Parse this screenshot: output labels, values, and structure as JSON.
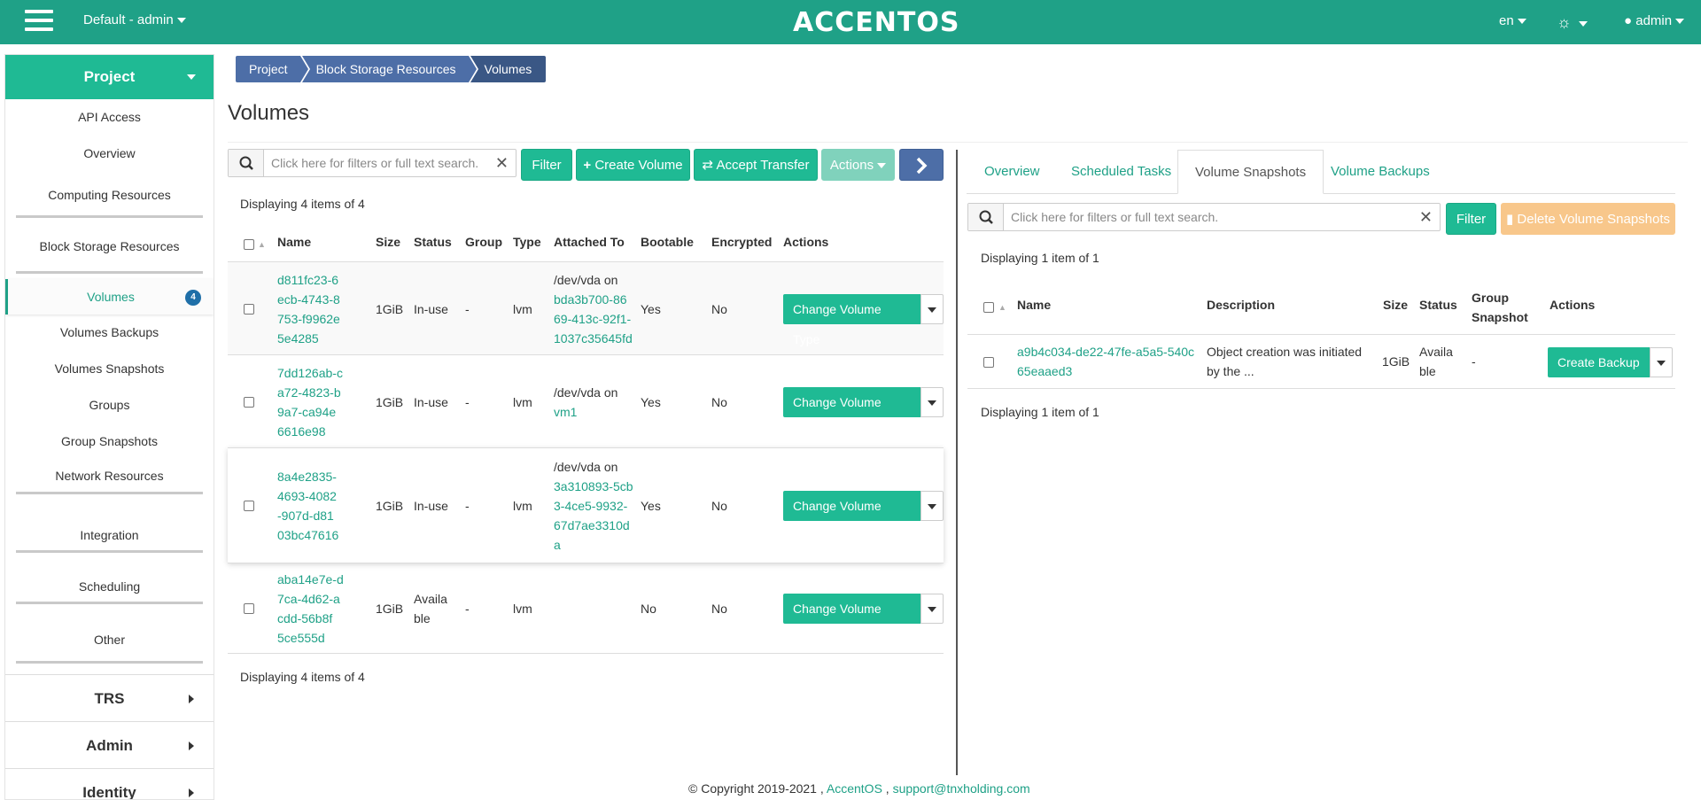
{
  "topbar": {
    "project_switch": "Default - admin",
    "logo": "ACCENTOS",
    "lang": "en",
    "user": "admin"
  },
  "sidebar": {
    "project": "Project",
    "items": [
      {
        "label": "API Access",
        "kind": "sub"
      },
      {
        "label": "Overview",
        "kind": "sub"
      },
      {
        "label": "Computing Resources",
        "kind": "group"
      },
      {
        "label": "Block Storage Resources",
        "kind": "group"
      },
      {
        "label": "Volumes",
        "kind": "active",
        "badge": "4"
      },
      {
        "label": "Volumes Backups",
        "kind": "sub"
      },
      {
        "label": "Volumes Snapshots",
        "kind": "sub"
      },
      {
        "label": "Groups",
        "kind": "sub"
      },
      {
        "label": "Group Snapshots",
        "kind": "sub"
      },
      {
        "label": "Network Resources",
        "kind": "group"
      },
      {
        "label": "Integration",
        "kind": "group"
      },
      {
        "label": "Scheduling",
        "kind": "group"
      },
      {
        "label": "Other",
        "kind": "group"
      }
    ],
    "sections": [
      "TRS",
      "Admin",
      "Identity"
    ]
  },
  "breadcrumb": [
    "Project",
    "Block Storage Resources",
    "Volumes"
  ],
  "page_title": "Volumes",
  "volumes": {
    "search_placeholder": "Click here for filters or full text search.",
    "filter_label": "Filter",
    "create_label": "Create Volume",
    "accept_label": "Accept Transfer",
    "actions_label": "Actions",
    "count_text": "Displaying 4 items of 4",
    "columns": [
      "Name",
      "Size",
      "Status",
      "Group",
      "Type",
      "Attached To",
      "Bootable",
      "Encrypted",
      "Actions"
    ],
    "rows": [
      {
        "name": [
          "d811fc23-6",
          "ecb-4743-8",
          "753-f9962e",
          "5e4285"
        ],
        "size": "1GiB",
        "status": [
          "In-use"
        ],
        "group": "-",
        "type": "lvm",
        "attached_prefix": "/dev/vda on",
        "attached": [
          "bda3b700-86",
          "69-413c-92f1-",
          "1037c35645fd"
        ],
        "bootable": "Yes",
        "encrypted": "No",
        "action": "Change Volume Type"
      },
      {
        "name": [
          "7dd126ab-c",
          "a72-4823-b",
          "9a7-ca94e",
          "6616e98"
        ],
        "size": "1GiB",
        "status": [
          "In-use"
        ],
        "group": "-",
        "type": "lvm",
        "attached_prefix": "/dev/vda on",
        "attached": [
          "vm1"
        ],
        "bootable": "Yes",
        "encrypted": "No",
        "action": "Change Volume Type"
      },
      {
        "name": [
          "8a4e2835-",
          "4693-4082",
          "-907d-d81",
          "03bc47616"
        ],
        "size": "1GiB",
        "status": [
          "In-use"
        ],
        "group": "-",
        "type": "lvm",
        "attached_prefix": "/dev/vda on",
        "attached": [
          "3a310893-5cb",
          "3-4ce5-9932-",
          "67d7ae3310d",
          "a"
        ],
        "bootable": "Yes",
        "encrypted": "No",
        "action": "Change Volume Type"
      },
      {
        "name": [
          "aba14e7e-d",
          "7ca-4d62-a",
          "cdd-56b8f",
          "5ce555d"
        ],
        "size": "1GiB",
        "status": [
          "Availa",
          "ble"
        ],
        "group": "-",
        "type": "lvm",
        "attached_prefix": "",
        "attached": [],
        "bootable": "No",
        "encrypted": "No",
        "action": "Change Volume Type"
      }
    ],
    "footer_text": "Displaying 4 items of 4"
  },
  "detail": {
    "tabs": [
      "Overview",
      "Scheduled Tasks",
      "Volume Snapshots",
      "Volume Backups"
    ],
    "active_tab": "Volume Snapshots",
    "search_placeholder": "Click here for filters or full text search.",
    "filter_label": "Filter",
    "delete_label": "Delete Volume Snapshots",
    "count_text": "Displaying 1 item of 1",
    "columns": [
      "Name",
      "Description",
      "Size",
      "Status",
      "Group Snapshot",
      "Actions"
    ],
    "rows": [
      {
        "name": [
          "a9b4c034-de22-47fe-a5a5-540c",
          "65eaaed3"
        ],
        "description": [
          "Object creation was initiated",
          "by the ..."
        ],
        "size": "1GiB",
        "status": [
          "Availa",
          "ble"
        ],
        "group_snapshot": "-",
        "action": "Create Backup"
      }
    ],
    "footer_text": "Displaying 1 item of 1"
  },
  "footer": {
    "copyright": "© Copyright 2019-2021 ,",
    "brand": "AccentOS",
    "sep": ",",
    "email": "support@tnxholding.com"
  },
  "colors": {
    "primary": "#1fba94",
    "topbar": "#1fa187",
    "crumb": "#4d6ea7",
    "warn": "#f8c78b"
  }
}
